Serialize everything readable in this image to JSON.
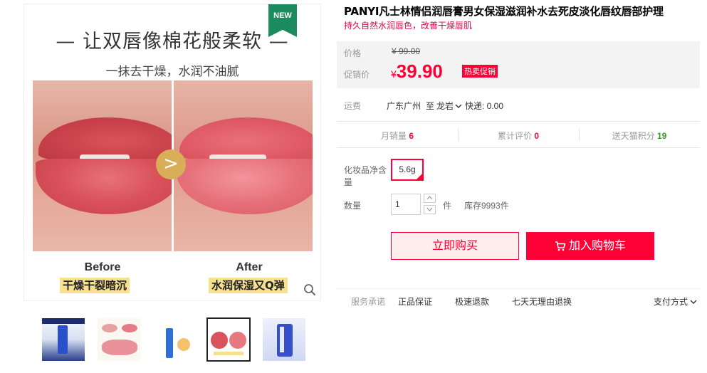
{
  "gallery": {
    "badge": "NEW",
    "headline": "— 让双唇像棉花般柔软 —",
    "subline": "一抹去干燥，水润不油腻",
    "before_label": "Before",
    "before_caption": "干燥干裂暗沉",
    "after_label": "After",
    "after_caption": "水润保湿又Q弹",
    "arrow_glyph": ">",
    "zoom_icon": "magnifier-icon",
    "thumbnails": [
      {
        "name": "thumb-1"
      },
      {
        "name": "thumb-2"
      },
      {
        "name": "thumb-3"
      },
      {
        "name": "thumb-4",
        "active": true
      },
      {
        "name": "thumb-5"
      }
    ]
  },
  "product": {
    "title": "PANYI凡士林情侣润唇膏男女保湿滋润补水去死皮淡化唇纹唇部护理",
    "subtitle": "持久自然水润唇色，改善干燥唇肌"
  },
  "price": {
    "orig_label": "价格",
    "orig_value": "¥ 99.00",
    "promo_label": "促销价",
    "currency": "¥",
    "promo_value": "39.90",
    "hot_tag": "热卖促销"
  },
  "shipping": {
    "label": "运费",
    "from": "广东广州",
    "to_word": "至",
    "to": "龙岩",
    "express": "快递: 0.00"
  },
  "stats": {
    "monthly_label": "月销量",
    "monthly_value": "6",
    "reviews_label": "累计评价",
    "reviews_value": "0",
    "points_label": "送天猫积分",
    "points_value": "19"
  },
  "spec": {
    "label": "化妆品净含量",
    "option": "5.6g"
  },
  "quantity": {
    "label": "数量",
    "value": "1",
    "unit": "件",
    "stock": "库存9993件"
  },
  "actions": {
    "buy_now": "立即购买",
    "add_cart": "加入购物车"
  },
  "service": {
    "label": "服务承诺",
    "items": [
      "正品保证",
      "极速退款",
      "七天无理由退换"
    ],
    "payment": "支付方式"
  },
  "colors": {
    "accent": "#ff0036",
    "badge_green": "#1c8c5e",
    "highlight_yellow": "#f7e08f"
  }
}
